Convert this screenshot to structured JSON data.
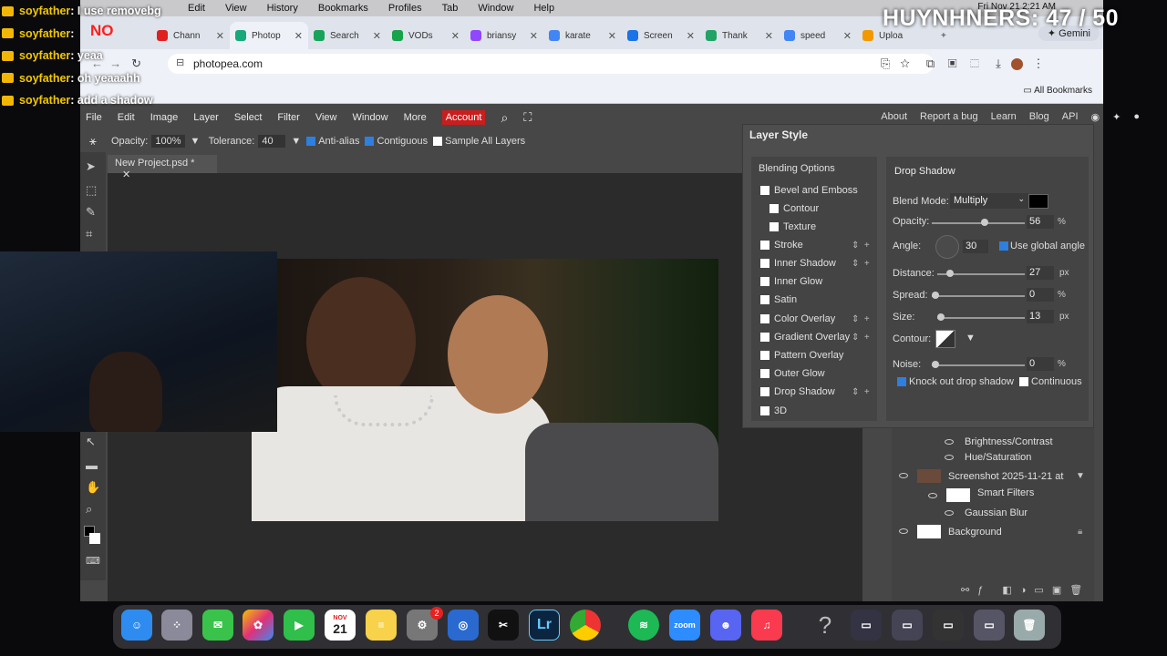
{
  "mac_menu": [
    "Edit",
    "View",
    "History",
    "Bookmarks",
    "Profiles",
    "Tab",
    "Window",
    "Help"
  ],
  "mac_clock": "Fri Nov 21  2:21 AM",
  "chat": [
    {
      "user": "soyfather",
      "msg": ": I use removebg"
    },
    {
      "user": "soyfather",
      "msg": ":"
    },
    {
      "user": "soyfather",
      "msg": ": yeaa"
    },
    {
      "user": "soyfather",
      "msg": ": oh yeaaahh"
    },
    {
      "user": "soyfather",
      "msg": ": add a shadow"
    }
  ],
  "chat_no": "NO",
  "counter": "HUYNHNERS: 47 / 50",
  "tabs": [
    {
      "title": "Chann",
      "color": "#e02020"
    },
    {
      "title": "Photop",
      "color": "#18a97a",
      "active": true
    },
    {
      "title": "Search",
      "color": "#19a35a"
    },
    {
      "title": "VODs",
      "color": "#16a34a"
    },
    {
      "title": "briansy",
      "color": "#9146ff"
    },
    {
      "title": "karate",
      "color": "#4285f4"
    },
    {
      "title": "Screen",
      "color": "#1a73e8"
    },
    {
      "title": "Thank",
      "color": "#21a366"
    },
    {
      "title": "speed",
      "color": "#4285f4"
    },
    {
      "title": "Uploa",
      "color": "#f29900"
    }
  ],
  "gemini": "Gemini",
  "url": "photopea.com",
  "all_bookmarks": "All Bookmarks",
  "pp_menu": [
    "File",
    "Edit",
    "Image",
    "Layer",
    "Select",
    "Filter",
    "View",
    "Window",
    "More"
  ],
  "pp_account": "Account",
  "pp_right": [
    "About",
    "Report a bug",
    "Learn",
    "Blog",
    "API"
  ],
  "options": {
    "opacity_label": "Opacity:",
    "opacity_value": "100%",
    "tolerance_label": "Tolerance:",
    "tolerance_value": "40",
    "antialias": "Anti-alias",
    "contiguous": "Contiguous",
    "sample_all": "Sample All Layers"
  },
  "doc_tab": "New Project.psd *",
  "layer_style": {
    "title": "Layer Style",
    "blending_options": "Blending Options",
    "items": [
      {
        "label": "Bevel and Emboss",
        "plus": false
      },
      {
        "label": "Contour",
        "plus": false,
        "indent": true
      },
      {
        "label": "Texture",
        "plus": false,
        "indent": true
      },
      {
        "label": "Stroke",
        "plus": true
      },
      {
        "label": "Inner Shadow",
        "plus": true
      },
      {
        "label": "Inner Glow",
        "plus": false
      },
      {
        "label": "Satin",
        "plus": false
      },
      {
        "label": "Color Overlay",
        "plus": true
      },
      {
        "label": "Gradient Overlay",
        "plus": true
      },
      {
        "label": "Pattern Overlay",
        "plus": false
      },
      {
        "label": "Outer Glow",
        "plus": false
      },
      {
        "label": "Drop Shadow",
        "plus": true
      },
      {
        "label": "3D",
        "plus": false
      }
    ],
    "section": "Drop Shadow",
    "blend_mode_label": "Blend Mode:",
    "blend_mode": "Multiply",
    "opacity_label": "Opacity:",
    "opacity": "56",
    "opacity_unit": "%",
    "angle_label": "Angle:",
    "angle": "30",
    "use_global": "Use global angle",
    "distance_label": "Distance:",
    "distance": "27",
    "distance_unit": "px",
    "spread_label": "Spread:",
    "spread": "0",
    "spread_unit": "%",
    "size_label": "Size:",
    "size": "13",
    "size_unit": "px",
    "contour_label": "Contour:",
    "noise_label": "Noise:",
    "noise": "0",
    "noise_unit": "%",
    "knockout": "Knock out drop shadow",
    "continuous": "Continuous"
  },
  "layers": {
    "brightness": "Brightness/Contrast",
    "hue": "Hue/Saturation",
    "screenshot": "Screenshot 2025-11-21 at",
    "smart_filters": "Smart Filters",
    "gaussian": "Gaussian Blur",
    "background": "Background"
  },
  "dock": {
    "calendar_month": "NOV",
    "calendar_day": "21",
    "badge": "2",
    "zoom": "zoom",
    "lr": "Lr",
    "help": "?"
  }
}
